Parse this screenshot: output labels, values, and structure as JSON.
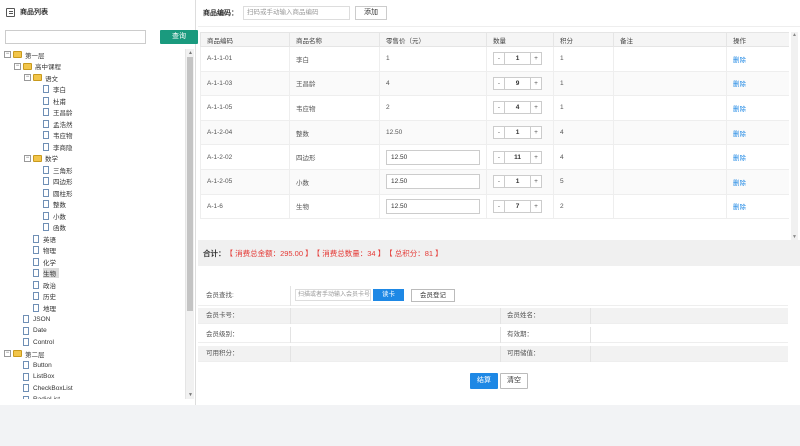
{
  "left": {
    "title": "商品列表",
    "search_button": "查询",
    "tree": [
      {
        "label": "第一层",
        "level": 0,
        "type": "folder",
        "toggle": "⊟"
      },
      {
        "label": "高中课程",
        "level": 1,
        "type": "folder",
        "toggle": "⊟"
      },
      {
        "label": "语文",
        "level": 2,
        "type": "folder",
        "toggle": "⊟"
      },
      {
        "label": "李白",
        "level": 3,
        "type": "file"
      },
      {
        "label": "杜甫",
        "level": 3,
        "type": "file"
      },
      {
        "label": "王昌龄",
        "level": 3,
        "type": "file"
      },
      {
        "label": "孟浩然",
        "level": 3,
        "type": "file"
      },
      {
        "label": "韦应物",
        "level": 3,
        "type": "file"
      },
      {
        "label": "李商隐",
        "level": 3,
        "type": "file"
      },
      {
        "label": "数学",
        "level": 2,
        "type": "folder",
        "toggle": "⊟"
      },
      {
        "label": "三角形",
        "level": 3,
        "type": "file"
      },
      {
        "label": "四边形",
        "level": 3,
        "type": "file"
      },
      {
        "label": "圆柱形",
        "level": 3,
        "type": "file"
      },
      {
        "label": "整数",
        "level": 3,
        "type": "file"
      },
      {
        "label": "小数",
        "level": 3,
        "type": "file"
      },
      {
        "label": "函数",
        "level": 3,
        "type": "file"
      },
      {
        "label": "英语",
        "level": 2,
        "type": "file"
      },
      {
        "label": "物理",
        "level": 2,
        "type": "file"
      },
      {
        "label": "化学",
        "level": 2,
        "type": "file"
      },
      {
        "label": "生物",
        "level": 2,
        "type": "file",
        "selected": true
      },
      {
        "label": "政治",
        "level": 2,
        "type": "file"
      },
      {
        "label": "历史",
        "level": 2,
        "type": "file"
      },
      {
        "label": "地理",
        "level": 2,
        "type": "file"
      },
      {
        "label": "JSON",
        "level": 1,
        "type": "file"
      },
      {
        "label": "Date",
        "level": 1,
        "type": "file"
      },
      {
        "label": "Control",
        "level": 1,
        "type": "file"
      },
      {
        "label": "第二层",
        "level": 0,
        "type": "folder",
        "toggle": "⊟"
      },
      {
        "label": "Button",
        "level": 1,
        "type": "file"
      },
      {
        "label": "ListBox",
        "level": 1,
        "type": "file"
      },
      {
        "label": "CheckBoxList",
        "level": 1,
        "type": "file"
      },
      {
        "label": "RadioList",
        "level": 1,
        "type": "file"
      }
    ]
  },
  "toolbar": {
    "code_label": "商品编码：",
    "code_placeholder": "扫码或手动输入商品编码",
    "add_button": "添加"
  },
  "table": {
    "headers": [
      "商品编码",
      "商品名称",
      "零售价（元）",
      "数量",
      "积分",
      "备注",
      "操作"
    ],
    "rows": [
      {
        "code": "A-1-1-01",
        "name": "李白",
        "price": "1",
        "price_input": false,
        "qty": "1",
        "points": "1",
        "note": "",
        "action": "删除"
      },
      {
        "code": "A-1-1-03",
        "name": "王昌龄",
        "price": "4",
        "price_input": false,
        "qty": "9",
        "points": "1",
        "note": "",
        "action": "删除"
      },
      {
        "code": "A-1-1-05",
        "name": "韦应物",
        "price": "2",
        "price_input": false,
        "qty": "4",
        "points": "1",
        "note": "",
        "action": "删除"
      },
      {
        "code": "A-1-2-04",
        "name": "整数",
        "price": "12.50",
        "price_input": false,
        "qty": "1",
        "points": "4",
        "note": "",
        "action": "删除"
      },
      {
        "code": "A-1-2-02",
        "name": "四边形",
        "price": "12.50",
        "price_input": true,
        "qty": "11",
        "points": "4",
        "note": "",
        "action": "删除"
      },
      {
        "code": "A-1-2-05",
        "name": "小数",
        "price": "12.50",
        "price_input": true,
        "qty": "1",
        "points": "5",
        "note": "",
        "action": "删除"
      },
      {
        "code": "A-1-6",
        "name": "生物",
        "price": "12.50",
        "price_input": true,
        "qty": "7",
        "points": "2",
        "note": "",
        "action": "删除"
      }
    ],
    "stepper_minus": "-",
    "stepper_plus": "+"
  },
  "summary": {
    "label": "合计：",
    "items": [
      "【 消费总金额：295.00 】",
      "【 消费总数量：34 】",
      "【 总积分：81 】"
    ],
    "accent": "#e53935"
  },
  "member": {
    "search_label": "会员查找:",
    "search_placeholder": "扫描或者手动输入会员卡号",
    "read_card_button": "读卡",
    "register_button": "会员登记",
    "card_no_label": "会员卡号：",
    "name_label": "会员姓名：",
    "level_label": "会员级别：",
    "expiry_label": "有效期：",
    "points_label": "可用积分：",
    "balance_label": "可用储值："
  },
  "actions": {
    "settle_button": "结算",
    "clear_button": "清空"
  },
  "colors": {
    "primary": "#1e88e5",
    "search_button": "#1a9a7e"
  }
}
